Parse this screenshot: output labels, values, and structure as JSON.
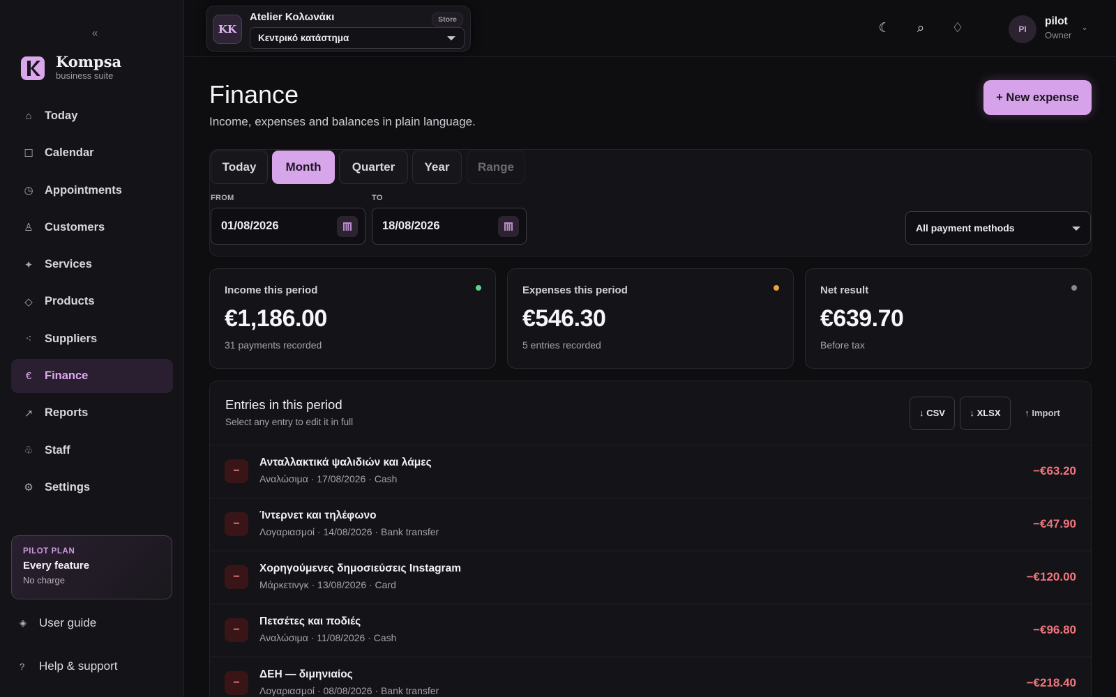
{
  "sidebar": {
    "collapse_glyph": "«",
    "brand": {
      "name": "Kompsa",
      "subtitle": "business suite"
    },
    "nav": [
      {
        "label": "Today",
        "icon": "home-icon",
        "glyph": "⌂"
      },
      {
        "label": "Calendar",
        "icon": "calendar-icon",
        "glyph": "☐"
      },
      {
        "label": "Appointments",
        "icon": "clock-icon",
        "glyph": "◷"
      },
      {
        "label": "Customers",
        "icon": "person-icon",
        "glyph": "♙"
      },
      {
        "label": "Services",
        "icon": "sparkle-icon",
        "glyph": "✦"
      },
      {
        "label": "Products",
        "icon": "diamond-icon",
        "glyph": "◇"
      },
      {
        "label": "Suppliers",
        "icon": "nodes-icon",
        "glyph": "⁖"
      },
      {
        "label": "Finance",
        "icon": "euro-icon",
        "glyph": "€",
        "active": true
      },
      {
        "label": "Reports",
        "icon": "arrow-up-right-icon",
        "glyph": "↗"
      },
      {
        "label": "Staff",
        "icon": "staff-icon",
        "glyph": "♧"
      },
      {
        "label": "Settings",
        "icon": "gear-icon",
        "glyph": "⚙"
      }
    ],
    "plan": {
      "kicker": "PILOT PLAN",
      "title": "Every feature",
      "subtitle": "No charge"
    },
    "user_guide": {
      "label": "User guide",
      "icon": "book-diamond-icon",
      "glyph": "◈"
    },
    "help": {
      "label": "Help & support",
      "icon": "question-icon",
      "glyph": "?"
    }
  },
  "topbar": {
    "store": {
      "initials": "KK",
      "name": "Atelier Κολωνάκι",
      "badge": "Store",
      "location": "Κεντρικό κατάστημα"
    },
    "icons": [
      {
        "name": "moon-icon",
        "glyph": "☾"
      },
      {
        "name": "search-icon",
        "glyph": "⌕"
      },
      {
        "name": "diamond-outline-icon",
        "glyph": "♢"
      }
    ],
    "user": {
      "initials": "PI",
      "name": "pilot",
      "role": "Owner",
      "caret": "⌄"
    }
  },
  "page": {
    "title": "Finance",
    "subtitle": "Income, expenses and balances in plain language.",
    "new_expense_label": "+ New expense"
  },
  "filters": {
    "periods": [
      {
        "label": "Today",
        "state": "normal"
      },
      {
        "label": "Month",
        "state": "active"
      },
      {
        "label": "Quarter",
        "state": "normal"
      },
      {
        "label": "Year",
        "state": "normal"
      },
      {
        "label": "Range",
        "state": "disabled"
      }
    ],
    "from_label": "FROM",
    "from_value": "01/08/2026",
    "to_label": "TO",
    "to_value": "18/08/2026",
    "payment_method": "All payment methods"
  },
  "stats": [
    {
      "label": "Income this period",
      "value": "€1,186.00",
      "sub": "31 payments recorded",
      "dot_color": "#5fd28a"
    },
    {
      "label": "Expenses this period",
      "value": "€546.30",
      "sub": "5 entries recorded",
      "dot_color": "#f0a23c"
    },
    {
      "label": "Net result",
      "value": "€639.70",
      "sub": "Before tax",
      "dot_color": "#8a878f"
    }
  ],
  "entries": {
    "title": "Entries in this period",
    "subtitle": "Select any entry to edit it in full",
    "csv_label": "↓ CSV",
    "xlsx_label": "↓ XLSX",
    "import_label": "↑ Import",
    "rows": [
      {
        "mark": "−",
        "title": "Ανταλλακτικά ψαλιδιών και λάμες",
        "meta": "Αναλώσιμα · 17/08/2026 · Cash",
        "amount": "−€63.20"
      },
      {
        "mark": "−",
        "title": "Ίντερνετ και τηλέφωνο",
        "meta": "Λογαριασμοί · 14/08/2026 · Bank transfer",
        "amount": "−€47.90"
      },
      {
        "mark": "−",
        "title": "Χορηγούμενες δημοσιεύσεις Instagram",
        "meta": "Μάρκετινγκ · 13/08/2026 · Card",
        "amount": "−€120.00"
      },
      {
        "mark": "−",
        "title": "Πετσέτες και ποδιές",
        "meta": "Αναλώσιμα · 11/08/2026 · Cash",
        "amount": "−€96.80"
      },
      {
        "mark": "−",
        "title": "ΔΕΗ — διμηνιαίος",
        "meta": "Λογαριασμοί · 08/08/2026 · Bank transfer",
        "amount": "−€218.40"
      }
    ]
  },
  "colors": {
    "accent": "#d6a3ea",
    "negative": "#f0767d",
    "background": "#0e0d10",
    "panel": "#141317"
  }
}
